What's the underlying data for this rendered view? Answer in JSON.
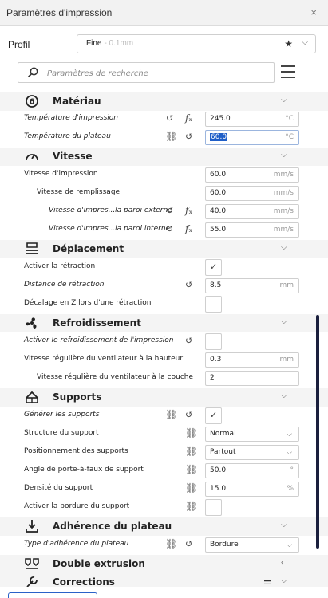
{
  "window": {
    "title": "Paramètres d'impression",
    "close_label": "×"
  },
  "profile": {
    "label": "Profil",
    "name": "Fine",
    "subtitle": "- 0.1mm",
    "star": "★",
    "chevron": "⌵"
  },
  "search": {
    "placeholder": "Paramètres de recherche"
  },
  "sections": {
    "materiau": "Matériau",
    "vitesse": "Vitesse",
    "deplacement": "Déplacement",
    "refroidissement": "Refroidissement",
    "supports": "Supports",
    "adherence": "Adhérence du plateau",
    "double_extrusion": "Double extrusion",
    "corrections": "Corrections"
  },
  "settings": {
    "temp_impression": {
      "label": "Température d'impression",
      "value": "245.0",
      "unit": "°C"
    },
    "temp_plateau": {
      "label": "Température du plateau",
      "value": "60.0",
      "unit": "°C"
    },
    "vitesse_impression": {
      "label": "Vitesse d'impression",
      "value": "60.0",
      "unit": "mm/s"
    },
    "vitesse_remplissage": {
      "label": "Vitesse de remplissage",
      "value": "60.0",
      "unit": "mm/s"
    },
    "vitesse_paroi_externe": {
      "label": "Vitesse d'impres...la paroi externe",
      "value": "40.0",
      "unit": "mm/s"
    },
    "vitesse_paroi_interne": {
      "label": "Vitesse d'impres...la paroi interne",
      "value": "55.0",
      "unit": "mm/s"
    },
    "activer_retraction": {
      "label": "Activer la rétraction",
      "checked": true
    },
    "distance_retraction": {
      "label": "Distance de rétraction",
      "value": "8.5",
      "unit": "mm"
    },
    "decalage_z": {
      "label": "Décalage en Z lors d'une rétraction",
      "checked": false
    },
    "activer_refroidissement": {
      "label": "Activer le refroidissement de l'impression",
      "checked": false
    },
    "vitesse_vent_hauteur": {
      "label": "Vitesse régulière du ventilateur à la hauteur",
      "value": "0.3",
      "unit": "mm"
    },
    "vitesse_vent_couche": {
      "label": "Vitesse régulière du ventilateur à la couche",
      "value": "2",
      "unit": ""
    },
    "generer_supports": {
      "label": "Générer les supports",
      "checked": true
    },
    "structure_support": {
      "label": "Structure du support",
      "value": "Normal"
    },
    "positionnement_supports": {
      "label": "Positionnement des supports",
      "value": "Partout"
    },
    "angle_porte_a_faux": {
      "label": "Angle de porte-à-faux de support",
      "value": "50.0",
      "unit": "°"
    },
    "densite_support": {
      "label": "Densité du support",
      "value": "15.0",
      "unit": "%"
    },
    "bordure_support": {
      "label": "Activer la bordure du support",
      "checked": false
    },
    "type_adherence": {
      "label": "Type d'adhérence du plateau",
      "value": "Bordure"
    }
  },
  "icons": {
    "reset": "↺",
    "function": "𝑓ₓ",
    "link": "⛓",
    "check": "✓",
    "chevron_down": "⌵",
    "chevron_left": "‹"
  },
  "colors": {
    "selection": "#1e5ec8",
    "scroll_thumb": "#1a1f3d",
    "accent": "#2a61c8"
  }
}
